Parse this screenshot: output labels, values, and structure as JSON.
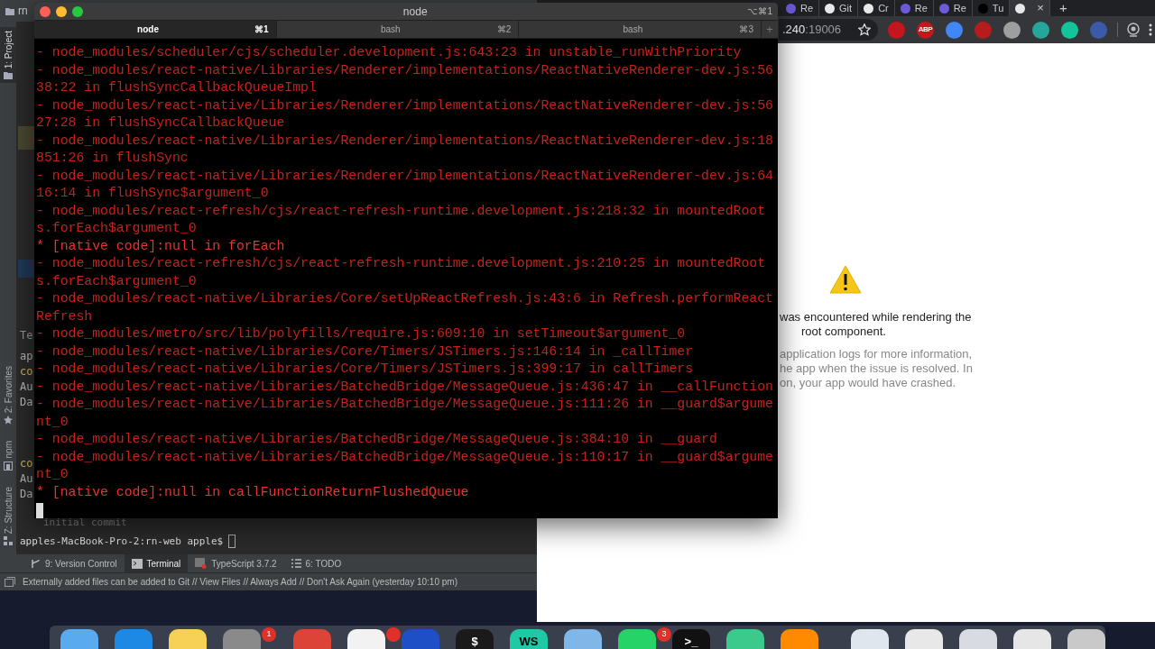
{
  "ide": {
    "project": "rn",
    "side_tabs": [
      {
        "label": "1: Project",
        "selected": true,
        "kind": "folder"
      },
      {
        "label": "2: Favorites",
        "selected": false,
        "kind": "star"
      },
      {
        "label": "npm",
        "selected": false,
        "kind": "npm"
      },
      {
        "label": "Z: Structure",
        "selected": false,
        "kind": "structure"
      }
    ],
    "fragments": [
      {
        "text": "Te",
        "kind": "header"
      },
      {
        "text": "ap",
        "kind": "plain"
      },
      {
        "text": "co",
        "kind": "commit"
      },
      {
        "text": "Au",
        "kind": "plain"
      },
      {
        "text": "Da",
        "kind": "plain"
      },
      {
        "text": "co",
        "kind": "commit"
      },
      {
        "text": "Au",
        "kind": "plain"
      },
      {
        "text": "Da",
        "kind": "plain"
      }
    ],
    "terminal_lines": [
      {
        "text": "initial commit",
        "kind": "output"
      },
      {
        "text": "apples-MacBook-Pro-2:rn-web apple$",
        "kind": "prompt"
      }
    ],
    "tool_tabs": [
      {
        "label": "9: Version Control",
        "selected": false,
        "kind": "vcs"
      },
      {
        "label": "Terminal",
        "selected": true,
        "kind": "terminal"
      },
      {
        "label": "TypeScript 3.7.2",
        "selected": false,
        "kind": "typescript"
      },
      {
        "label": "6: TODO",
        "selected": false,
        "kind": "todo"
      }
    ],
    "status": "Externally added files can be added to Git // View Files // Always Add // Don't Ask Again (yesterday 10:10 pm)"
  },
  "browser": {
    "tabs": [
      {
        "label": "Re",
        "color": "#6b5bd6",
        "selected": false
      },
      {
        "label": "Git",
        "color": "#e8e8e8",
        "selected": false
      },
      {
        "label": "Cr",
        "color": "#e8e8e8",
        "selected": false
      },
      {
        "label": "Re",
        "color": "#6b5bd6",
        "selected": false
      },
      {
        "label": "Re",
        "color": "#6b5bd6",
        "selected": false
      },
      {
        "label": "Tu",
        "color": "#000000",
        "selected": false
      },
      {
        "color": "#e8e8e8",
        "selected": true
      }
    ],
    "close": "×",
    "new_tab": "+",
    "address": ".240",
    "port": ":19006",
    "extensions": [
      {
        "color": "#c4161c"
      },
      {
        "color": "#c4161c",
        "glyph": "ABP"
      },
      {
        "color": "#4285f4"
      },
      {
        "color": "#b71c1c"
      },
      {
        "color": "#9e9e9e"
      },
      {
        "color": "#26a69a"
      },
      {
        "color": "#15c39a"
      },
      {
        "color": "#3c5aa8"
      }
    ],
    "error_lines": [
      "was encountered while rendering the",
      "root component."
    ],
    "hint_lines": [
      "application logs for more information,",
      "he app when the issue is resolved. In",
      "on, your app would have crashed."
    ]
  },
  "terminal": {
    "title": "node",
    "shortcut": "⌥⌘1",
    "tabs": [
      {
        "label": "node",
        "key": "⌘1",
        "selected": true
      },
      {
        "label": "bash",
        "key": "⌘2",
        "selected": false
      },
      {
        "label": "bash",
        "key": "⌘3",
        "selected": false
      }
    ],
    "new_tab": "+",
    "lines": [
      {
        "text": "- node_modules/scheduler/cjs/scheduler.development.js:643:23 in unstable_runWithPriority",
        "kind": "frame"
      },
      {
        "text": "- node_modules/react-native/Libraries/Renderer/implementations/ReactNativeRenderer-dev.js:5638:22 in flushSyncCallbackQueueImpl",
        "kind": "frame"
      },
      {
        "text": "- node_modules/react-native/Libraries/Renderer/implementations/ReactNativeRenderer-dev.js:5627:28 in flushSyncCallbackQueue",
        "kind": "frame"
      },
      {
        "text": "- node_modules/react-native/Libraries/Renderer/implementations/ReactNativeRenderer-dev.js:18851:26 in flushSync",
        "kind": "frame"
      },
      {
        "text": "- node_modules/react-native/Libraries/Renderer/implementations/ReactNativeRenderer-dev.js:6416:14 in flushSync$argument_0",
        "kind": "frame"
      },
      {
        "text": "- node_modules/react-refresh/cjs/react-refresh-runtime.development.js:218:32 in mountedRoots.forEach$argument_0",
        "kind": "frame"
      },
      {
        "text": "* [native code]:null in forEach",
        "kind": "native"
      },
      {
        "text": "- node_modules/react-refresh/cjs/react-refresh-runtime.development.js:210:25 in mountedRoots.forEach$argument_0",
        "kind": "frame"
      },
      {
        "text": "- node_modules/react-native/Libraries/Core/setUpReactRefresh.js:43:6 in Refresh.performReactRefresh",
        "kind": "frame"
      },
      {
        "text": "- node_modules/metro/src/lib/polyfills/require.js:609:10 in setTimeout$argument_0",
        "kind": "frame"
      },
      {
        "text": "- node_modules/react-native/Libraries/Core/Timers/JSTimers.js:146:14 in _callTimer",
        "kind": "frame"
      },
      {
        "text": "- node_modules/react-native/Libraries/Core/Timers/JSTimers.js:399:17 in callTimers",
        "kind": "frame"
      },
      {
        "text": "- node_modules/react-native/Libraries/BatchedBridge/MessageQueue.js:436:47 in __callFunction",
        "kind": "frame"
      },
      {
        "text": "- node_modules/react-native/Libraries/BatchedBridge/MessageQueue.js:111:26 in __guard$argument_0",
        "kind": "frame"
      },
      {
        "text": "- node_modules/react-native/Libraries/BatchedBridge/MessageQueue.js:384:10 in __guard",
        "kind": "frame"
      },
      {
        "text": "- node_modules/react-native/Libraries/BatchedBridge/MessageQueue.js:110:17 in __guard$argument_0",
        "kind": "frame"
      },
      {
        "text": "* [native code]:null in callFunctionReturnFlushedQueue",
        "kind": "native"
      }
    ]
  },
  "dock": {
    "items": [
      {
        "color": "#5aaaf0"
      },
      {
        "color": "#1e88e5"
      },
      {
        "color": "#f6d155"
      },
      {
        "color": "#8a8a8a",
        "badge": "1"
      },
      {
        "color": "#db4437"
      },
      {
        "color": "#f2f2f2",
        "dot": true
      },
      {
        "color": "#1f4fc7"
      },
      {
        "color": "#1a1a1a",
        "glyph": "$"
      },
      {
        "color": "#1fc9a6",
        "glyph": "WS"
      },
      {
        "color": "#7fb8e8"
      },
      {
        "color": "#25d366",
        "badge": "3"
      },
      {
        "color": "#111111",
        "glyph": ">_"
      },
      {
        "color": "#3cc98c"
      },
      {
        "color": "#ff8a00"
      },
      {
        "color": "#dfe6ee"
      },
      {
        "color": "#e8e8e8"
      },
      {
        "color": "#d8dce2"
      },
      {
        "color": "#e6e6e6"
      },
      {
        "color": "#c9c9c9"
      }
    ]
  }
}
